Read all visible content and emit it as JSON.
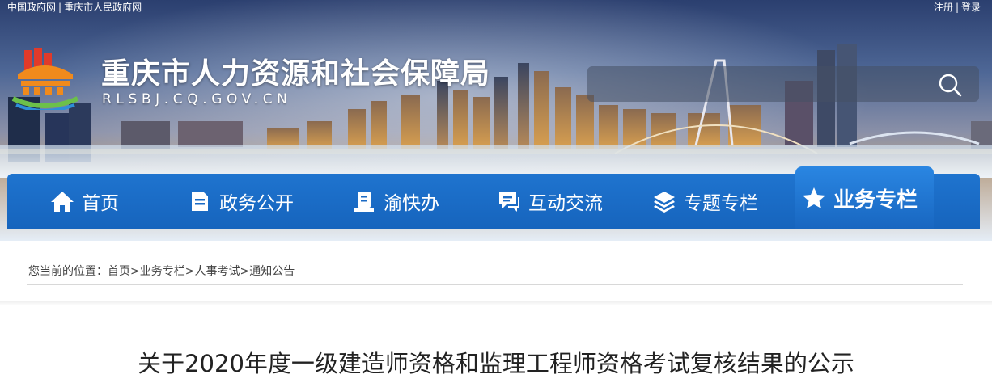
{
  "top_links": {
    "left": [
      "中国政府网",
      "重庆市人民政府网"
    ],
    "right": [
      "注册",
      "登录"
    ],
    "separator": "|"
  },
  "header": {
    "title": "重庆市人力资源和社会保障局",
    "domain": "RLSBJ.CQ.GOV.CN"
  },
  "search": {
    "value": "",
    "placeholder": ""
  },
  "nav": {
    "items": [
      {
        "label": "首页",
        "icon": "home-icon"
      },
      {
        "label": "政务公开",
        "icon": "document-icon"
      },
      {
        "label": "渝快办",
        "icon": "service-icon"
      },
      {
        "label": "互动交流",
        "icon": "chat-icon"
      },
      {
        "label": "专题专栏",
        "icon": "layers-icon"
      },
      {
        "label": "业务专栏",
        "icon": "star-icon",
        "active": true
      }
    ]
  },
  "breadcrumb": {
    "prefix": "您当前的位置：",
    "items": [
      "首页",
      "业务专栏",
      "人事考试",
      "通知公告"
    ],
    "separator": ">"
  },
  "article": {
    "title": "关于2020年度一级建造师资格和监理工程师资格考试复核结果的公示"
  },
  "colors": {
    "nav_blue": "#1664bd",
    "nav_active": "#2a86e2",
    "logo_orange": "#f08a1c",
    "logo_red": "#e03a2a",
    "logo_green": "#6cc04a"
  }
}
